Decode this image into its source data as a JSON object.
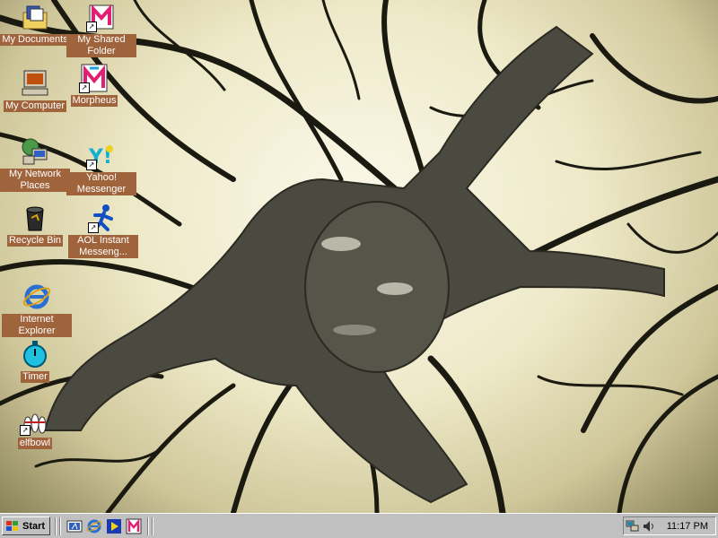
{
  "desktop": {
    "icons": [
      {
        "name": "my-documents",
        "label": "My Documents"
      },
      {
        "name": "my-shared-folder",
        "label": "My Shared Folder"
      },
      {
        "name": "my-computer",
        "label": "My Computer"
      },
      {
        "name": "morpheus",
        "label": "Morpheus"
      },
      {
        "name": "my-network-places",
        "label": "My Network Places"
      },
      {
        "name": "yahoo-messenger",
        "label": "Yahoo! Messenger"
      },
      {
        "name": "recycle-bin",
        "label": "Recycle Bin"
      },
      {
        "name": "aol-instant-messenger",
        "label": "AOL Instant Messeng..."
      },
      {
        "name": "internet-explorer",
        "label": "Internet Explorer"
      },
      {
        "name": "timer",
        "label": "Timer"
      },
      {
        "name": "elfbowl",
        "label": "elfbowl"
      }
    ]
  },
  "taskbar": {
    "start_label": "Start",
    "quick_launch": [
      "show-desktop-icon",
      "internet-explorer-icon",
      "media-player-icon",
      "morpheus-icon"
    ],
    "tray": {
      "icons": [
        "network-icon",
        "volume-icon"
      ],
      "clock": "11:17 PM"
    }
  },
  "colors": {
    "icon_label_bg": "#a0643c",
    "taskbar_bg": "#c0c0c0"
  }
}
